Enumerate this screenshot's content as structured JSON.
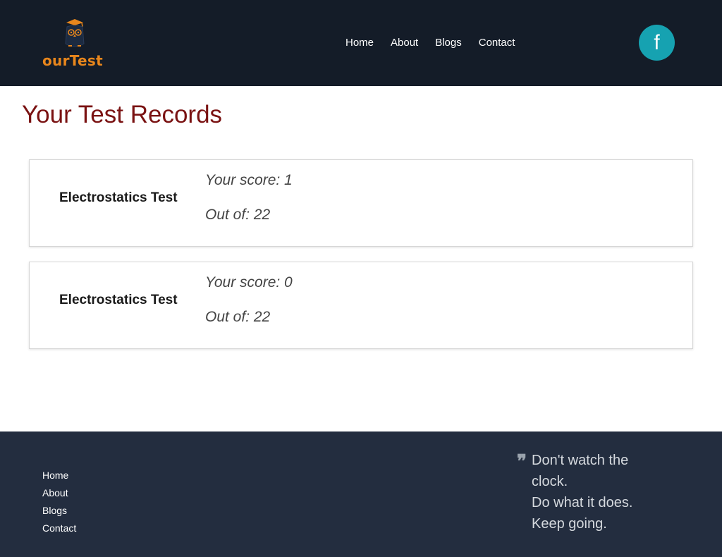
{
  "header": {
    "logo_text": "ourTest",
    "nav": [
      {
        "label": "Home"
      },
      {
        "label": "About"
      },
      {
        "label": "Blogs"
      },
      {
        "label": "Contact"
      }
    ],
    "social": {
      "facebook_label": "f",
      "accent": "#16a2b1"
    }
  },
  "main": {
    "title": "Your Test Records",
    "records": [
      {
        "name": "Electrostatics Test",
        "score": "Your score: 1",
        "out_of": "Out of: 22"
      },
      {
        "name": "Electrostatics Test",
        "score": "Your score: 0",
        "out_of": "Out of: 22"
      }
    ]
  },
  "footer": {
    "links": [
      {
        "label": "Home"
      },
      {
        "label": "About"
      },
      {
        "label": "Blogs"
      },
      {
        "label": "Contact"
      }
    ],
    "quote_mark": "❞",
    "quote_lines": [
      "Don't watch the",
      "clock.",
      "Do what it does.",
      "Keep going."
    ]
  },
  "colors": {
    "header_bg": "#141c28",
    "footer_bg": "#232d3f",
    "title": "#7a1212",
    "logo": "#e8861c"
  }
}
